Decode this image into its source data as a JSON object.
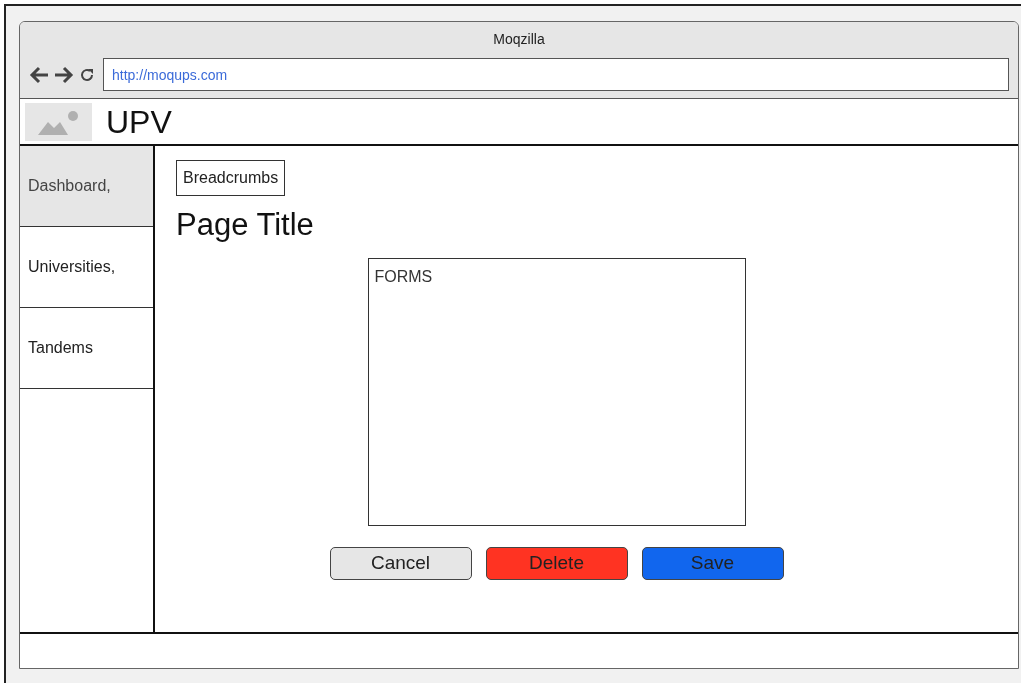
{
  "window": {
    "title": "Moqzilla",
    "url": "http://moqups.com"
  },
  "header": {
    "brand": "UPV"
  },
  "sidebar": {
    "items": [
      {
        "label": "Dashboard,",
        "selected": true
      },
      {
        "label": "Universities,",
        "selected": false
      },
      {
        "label": "Tandems",
        "selected": false
      }
    ]
  },
  "breadcrumbs": "Breadcrumbs",
  "page_title": "Page Title",
  "form": {
    "label": "FORMS"
  },
  "buttons": [
    {
      "label": "Cancel",
      "kind": "cancel"
    },
    {
      "label": "Delete",
      "kind": "delete"
    },
    {
      "label": "Save",
      "kind": "save"
    }
  ]
}
